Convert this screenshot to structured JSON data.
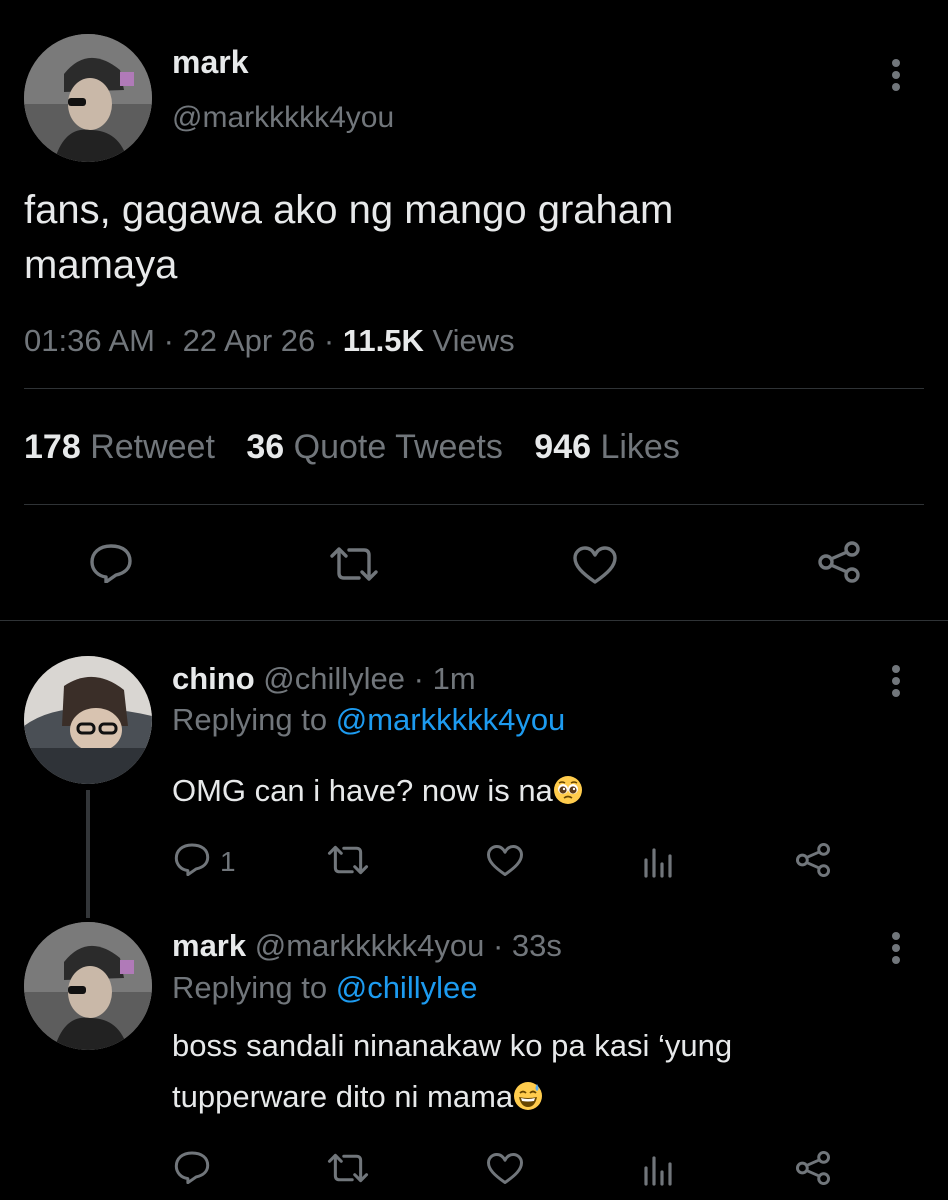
{
  "main_tweet": {
    "author_name": "mark",
    "author_handle": "@markkkkk4you",
    "text_line1": "fans, gagawa ako ng mango graham",
    "text_line2": "mamaya",
    "time": "01:36 AM",
    "sep1": "·",
    "date": "22 Apr 26",
    "sep2": "·",
    "views_count": "11.5K",
    "views_label": "Views",
    "stats": {
      "retweets_count": "178",
      "retweets_label": "Retweet",
      "quotes_count": "36",
      "quotes_label": "Quote Tweets",
      "likes_count": "946",
      "likes_label": "Likes"
    }
  },
  "replies": [
    {
      "author_name": "chino",
      "author_handle": "@chillylee",
      "sep": "·",
      "time": "1m",
      "replying_label": "Replying to",
      "replying_handle": "@markkkkk4you",
      "text": "OMG can i have? now is na",
      "emoji": "pleading-face",
      "reply_count": "1"
    },
    {
      "author_name": "mark",
      "author_handle": "@markkkkk4you",
      "sep": "·",
      "time": "33s",
      "replying_label": "Replying to",
      "replying_handle": "@chillylee",
      "text_line1": "boss sandali ninanakaw ko pa kasi ‘yung",
      "text_line2": "tupperware dito ni mama",
      "emoji": "grinning-face-with-sweat"
    }
  ],
  "colors": {
    "background": "#000000",
    "text": "#e7e9ea",
    "secondary": "#71767b",
    "accent": "#1d9bf0",
    "divider": "#2f3336"
  }
}
